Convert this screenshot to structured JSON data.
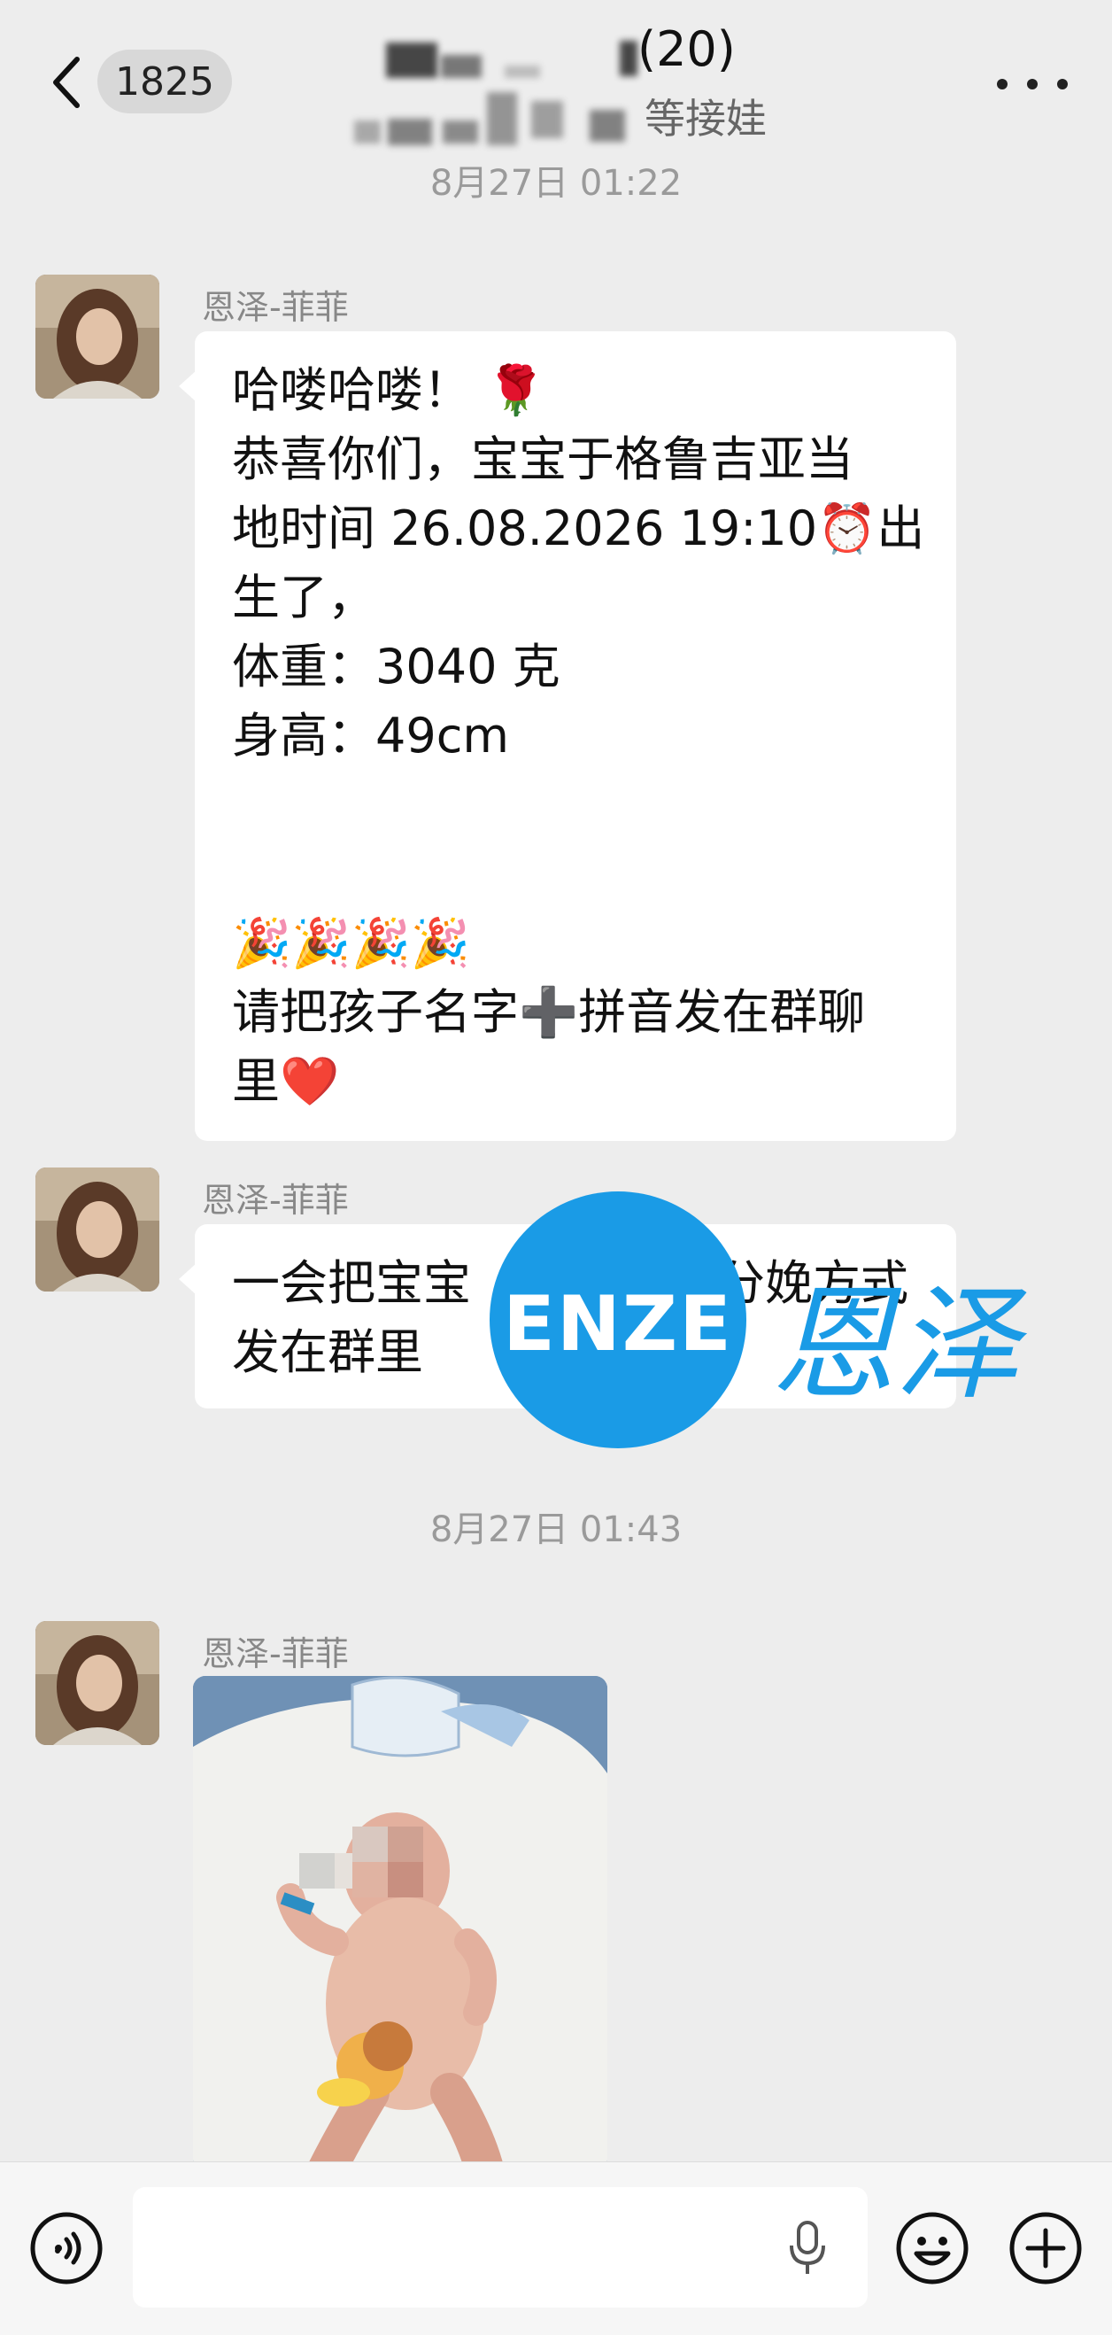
{
  "header": {
    "unread_count": "1825",
    "member_count": "(20)",
    "subtitle": "等接娃"
  },
  "timestamps": [
    "8月27日 01:22",
    "8月27日 01:43"
  ],
  "messages": [
    {
      "sender": "恩泽-菲菲",
      "lines": [
        "哈喽哈喽！ 🌹",
        "恭喜你们，宝宝于格鲁吉亚当",
        "地时间 26.08.2026 19:10⏰出",
        "生了，",
        "体重：3040 克",
        "身高：49cm",
        "",
        "",
        "🎉🎉🎉🎉",
        "请把孩子名字➕拼音发在群聊",
        "里❤️"
      ]
    },
    {
      "sender": "恩泽-菲菲",
      "lines": [
        "一会把宝宝",
        "发在群里"
      ],
      "partial_visible_text": "分娩方式"
    },
    {
      "sender": "恩泽-菲菲",
      "type": "image"
    }
  ],
  "watermark": {
    "latin": "ENZE",
    "chinese": "恩泽"
  },
  "colors": {
    "background": "#ededed",
    "bubble": "#ffffff",
    "watermark_blue": "#1a9be6",
    "meta_text": "#9a9a9a"
  },
  "icons": {
    "back": "chevron-left-icon",
    "more": "more-dots-icon",
    "voice": "voice-wave-icon",
    "mic": "microphone-icon",
    "emoji": "smiley-icon",
    "plus": "plus-circle-icon"
  }
}
